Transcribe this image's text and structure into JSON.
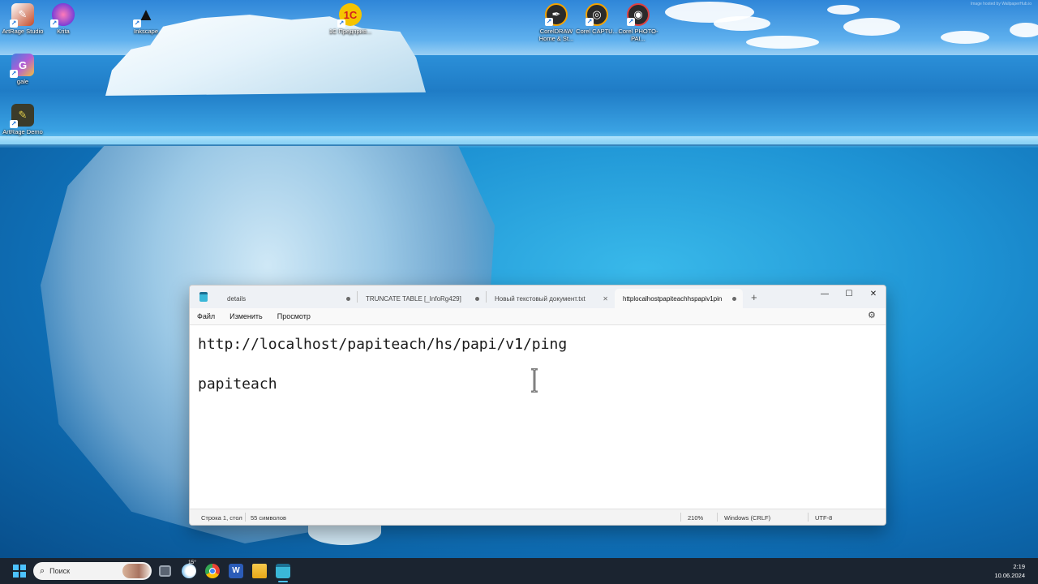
{
  "desktop": {
    "watermark": "Image hosted by WallpaperHub.io",
    "icons": [
      {
        "label": "ArtRage Studio",
        "icon": "artrage-icon",
        "color": "#c24b2a"
      },
      {
        "label": "Krita",
        "icon": "krita-icon",
        "color": "#d9508f"
      },
      {
        "label": "Inkscape",
        "icon": "inkscape-icon",
        "color": "#333333"
      },
      {
        "label": "1С Предприя...",
        "icon": "1c-icon",
        "color": "#f5c400"
      },
      {
        "label": "CorelDRAW Home & St...",
        "icon": "coreldraw-icon",
        "color": "#2b2b2b"
      },
      {
        "label": "Corel CAPTU...",
        "icon": "corel-capture-icon",
        "color": "#2b2b2b"
      },
      {
        "label": "Corel PHOTO-PAI...",
        "icon": "corel-photopaint-icon",
        "color": "#2b2b2b"
      },
      {
        "label": "gale",
        "icon": "gale-icon",
        "color": "#7b5cc9"
      },
      {
        "label": "ArtRage Demo",
        "icon": "artrage-demo-icon",
        "color": "#3b3b2a"
      }
    ]
  },
  "notepad": {
    "tabs": [
      {
        "label": "details",
        "modified": true,
        "active": false
      },
      {
        "label": "TRUNCATE TABLE [_InfoRg429]",
        "modified": true,
        "active": false
      },
      {
        "label": "Новый текстовый документ.txt",
        "modified": false,
        "active": false
      },
      {
        "label": "httplocalhostpapiteachhspapiv1pin",
        "modified": true,
        "active": true
      }
    ],
    "add_tab": "+",
    "window_controls": {
      "minimize": "—",
      "maximize": "☐",
      "close": "✕"
    },
    "menu": {
      "file": "Файл",
      "edit": "Изменить",
      "view": "Просмотр"
    },
    "content_line1": "http://localhost/papiteach/hs/papi/v1/ping",
    "content_line2": "",
    "content_line3": "papiteach",
    "status": {
      "position": "Строка 1, стол",
      "chars": "55 символов",
      "zoom": "210%",
      "line_endings": "Windows (CRLF)",
      "encoding": "UTF-8"
    }
  },
  "taskbar": {
    "search_placeholder": "Поиск",
    "weather_temp": "15°",
    "time": "2:19",
    "date": "10.06.2024",
    "accent": "#4cc2ff"
  }
}
